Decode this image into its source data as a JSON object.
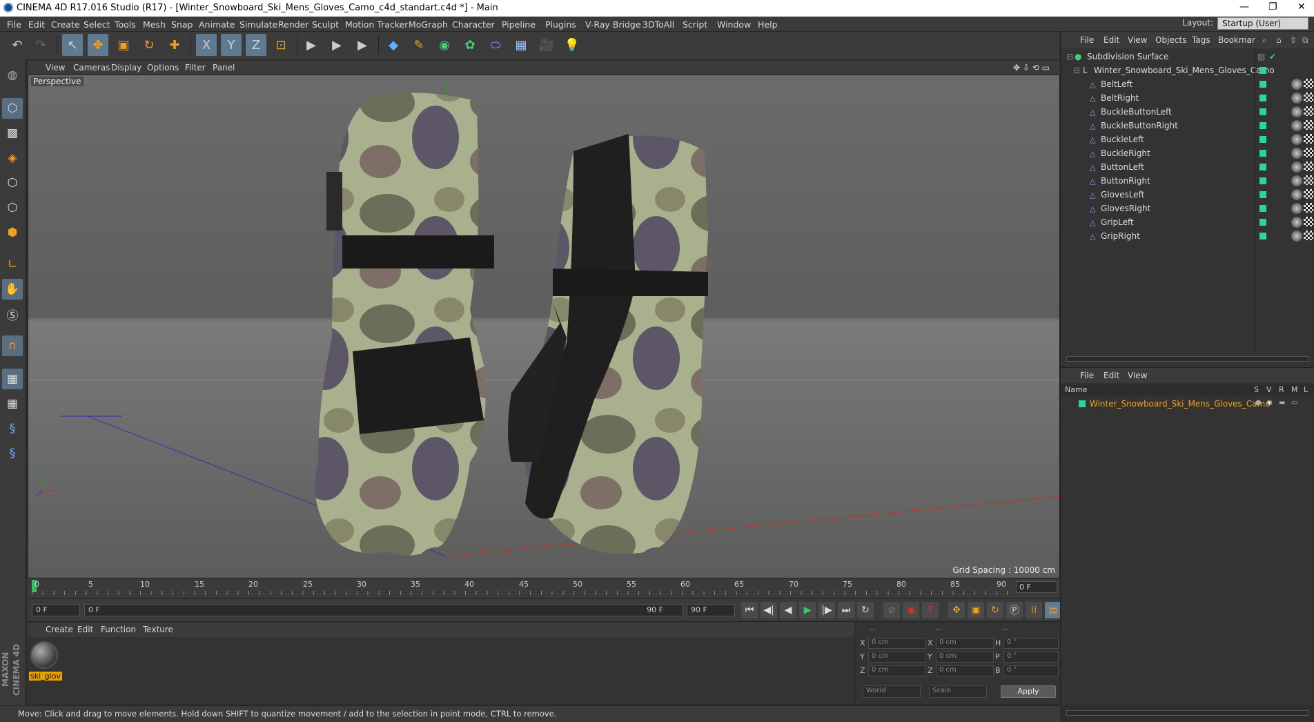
{
  "window": {
    "title": "CINEMA 4D R17.016 Studio (R17) - [Winter_Snowboard_Ski_Mens_Gloves_Camo_c4d_standart.c4d *] - Main",
    "minimize": "—",
    "restore": "❐",
    "close": "✕"
  },
  "menu": [
    "File",
    "Edit",
    "Create",
    "Select",
    "Tools",
    "Mesh",
    "Snap",
    "Animate",
    "Simulate",
    "Render",
    "Sculpt",
    "Motion Tracker",
    "MoGraph",
    "Character",
    "Pipeline",
    "Plugins",
    "V-Ray Bridge",
    "3DToAll",
    "Script",
    "Window",
    "Help"
  ],
  "layout": {
    "label": "Layout:",
    "value": "Startup (User)"
  },
  "toolbar": {
    "undo": "↶",
    "redo": "↷",
    "live_select": "↖",
    "move": "✥",
    "scale": "▣",
    "rotate": "↻",
    "add": "✚",
    "x_axis": "X",
    "y_axis": "Y",
    "z_axis": "Z",
    "coord": "⊡",
    "render_view": "▶",
    "render_pic": "▶",
    "render_settings": "▶",
    "cube": "◆",
    "spline": "✎",
    "nurbs": "◉",
    "array": "✿",
    "deformer": "⬭",
    "floor": "▦",
    "camera": "🎥",
    "light": "💡"
  },
  "viewport": {
    "menu": [
      "View",
      "Cameras",
      "Display",
      "Options",
      "Filter",
      "Panel"
    ],
    "label": "Perspective",
    "grid_spacing": "Grid Spacing : 10000 cm",
    "nav": "✥ ⇩ ⟲ ▭"
  },
  "timeline": {
    "ticks": [
      "0",
      "5",
      "10",
      "15",
      "20",
      "25",
      "30",
      "35",
      "40",
      "45",
      "50",
      "55",
      "60",
      "65",
      "70",
      "75",
      "80",
      "85",
      "90"
    ],
    "frame": "0 F"
  },
  "transport": {
    "start": "0 F",
    "range_start": "0 F",
    "range_end": "90 F",
    "end": "90 F",
    "buttons": [
      "⏮",
      "◀|",
      "◀",
      "▶",
      "|▶",
      "⏭",
      "↻"
    ]
  },
  "materials": {
    "menu": [
      "Create",
      "Edit",
      "Function",
      "Texture"
    ],
    "items": [
      {
        "name": "ski_glov"
      }
    ]
  },
  "coords": {
    "hdr": [
      "--",
      "--",
      "--"
    ],
    "rows": [
      {
        "a": "X",
        "av": "0 cm",
        "b": "X",
        "bv": "0 cm",
        "c": "H",
        "cv": "0 °"
      },
      {
        "a": "Y",
        "av": "0 cm",
        "b": "Y",
        "bv": "0 cm",
        "c": "P",
        "cv": "0 °"
      },
      {
        "a": "Z",
        "av": "0 cm",
        "b": "Z",
        "bv": "0 cm",
        "c": "B",
        "cv": "0 °"
      }
    ],
    "world": "World",
    "scale": "Scale",
    "apply": "Apply"
  },
  "status": "Move: Click and drag to move elements. Hold down SHIFT to quantize movement / add to the selection in point mode, CTRL to remove.",
  "objects": {
    "menu": [
      "File",
      "Edit",
      "View",
      "Objects",
      "Tags",
      "Bookmar"
    ],
    "root": "Subdivision Surface",
    "group": "Winter_Snowboard_Ski_Mens_Gloves_Camo",
    "children": [
      "BeltLeft",
      "BeltRight",
      "BuckleButtonLeft",
      "BuckleButtonRight",
      "BuckleLeft",
      "BuckleRight",
      "ButtonLeft",
      "ButtonRight",
      "GlovesLeft",
      "GlovesRight",
      "GripLeft",
      "GripRight"
    ]
  },
  "layers": {
    "menu": [
      "File",
      "Edit",
      "View"
    ],
    "headers": {
      "name": "Name",
      "s": "S",
      "v": "V",
      "r": "R",
      "m": "M",
      "l": "L"
    },
    "item": "Winter_Snowboard_Ski_Mens_Gloves_Camo"
  },
  "maxon": "MAXON CINEMA 4D",
  "colors": {
    "accent": "#e8a000",
    "green": "#2fd49a",
    "select": "#607a92"
  }
}
